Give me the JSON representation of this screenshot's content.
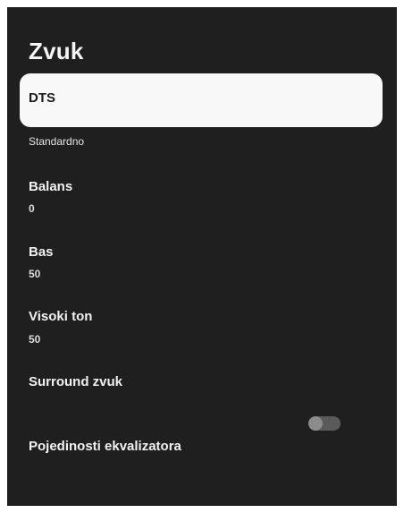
{
  "page": {
    "title": "Zvuk"
  },
  "items": {
    "dts": {
      "label": "DTS"
    },
    "dts_value": "Standardno",
    "balance": {
      "label": "Balans",
      "value": "0"
    },
    "bass": {
      "label": "Bas",
      "value": "50"
    },
    "treble": {
      "label": "Visoki ton",
      "value": "50"
    },
    "surround": {
      "label": "Surround zvuk",
      "enabled": false
    },
    "equalizer": {
      "label": "Pojedinosti ekvalizatora"
    }
  },
  "colors": {
    "panel_bg": "#1f1f1f",
    "focus_bg": "#f8f8f8",
    "text": "#f2f2f2",
    "toggle_track_off": "#5a5a5a",
    "toggle_knob_off": "#8c8c8c"
  }
}
